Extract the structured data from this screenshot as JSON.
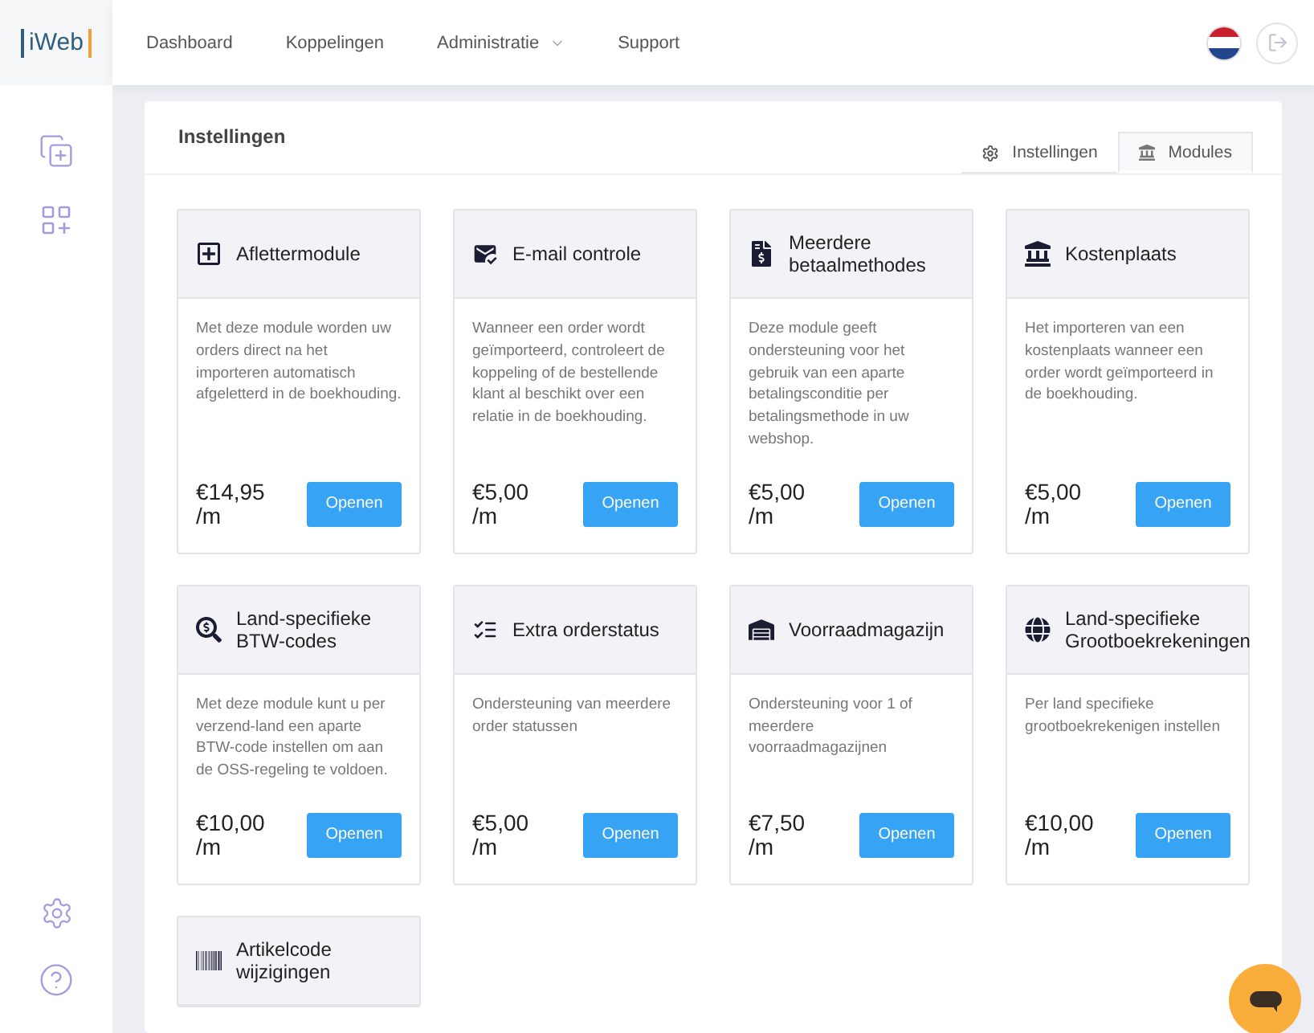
{
  "logo": "iWeb",
  "nav": [
    {
      "label": "Dashboard",
      "dropdown": false
    },
    {
      "label": "Koppelingen",
      "dropdown": false
    },
    {
      "label": "Administratie",
      "dropdown": true
    },
    {
      "label": "Support",
      "dropdown": false
    }
  ],
  "panel": {
    "title": "Instellingen",
    "tabs": [
      {
        "label": "Instellingen",
        "selected": false
      },
      {
        "label": "Modules",
        "selected": true
      }
    ]
  },
  "modules": [
    {
      "title": "Aflettermodule",
      "description": "Met deze module worden uw orders direct na het importeren automatisch afgeletterd in de boekhouding.",
      "price": "€14,95 /m",
      "button": "Openen"
    },
    {
      "title": "E-mail controle",
      "description": "Wanneer een order wordt geïmporteerd, controleert de koppeling of de bestellende klant al beschikt over een relatie in de boekhouding.",
      "price": "€5,00 /m",
      "button": "Openen"
    },
    {
      "title": "Meerdere betaalmethodes",
      "description": "Deze module geeft ondersteuning voor het gebruik van een aparte betalingsconditie per betalingsmethode in uw webshop.",
      "price": "€5,00 /m",
      "button": "Openen"
    },
    {
      "title": "Kostenplaats",
      "description": "Het importeren van een kostenplaats wanneer een order wordt geïmporteerd in de boekhouding.",
      "price": "€5,00 /m",
      "button": "Openen"
    },
    {
      "title": "Land-specifieke BTW-codes",
      "description": "Met deze module kunt u per verzend-land een aparte BTW-code instellen om aan de OSS-regeling te voldoen.",
      "price": "€10,00 /m",
      "button": "Openen"
    },
    {
      "title": "Extra orderstatus",
      "description": "Ondersteuning van meerdere order statussen",
      "price": "€5,00 /m",
      "button": "Openen"
    },
    {
      "title": "Voorraadmagazijn",
      "description": "Ondersteuning voor 1 of meerdere voorraadmagazijnen",
      "price": "€7,50 /m",
      "button": "Openen"
    },
    {
      "title": "Land-specifieke Grootboekrekeningen",
      "description": "Per land specifieke grootboekrekenigen instellen",
      "price": "€10,00 /m",
      "button": "Openen"
    },
    {
      "title": "Artikelcode wijzigingen"
    }
  ]
}
